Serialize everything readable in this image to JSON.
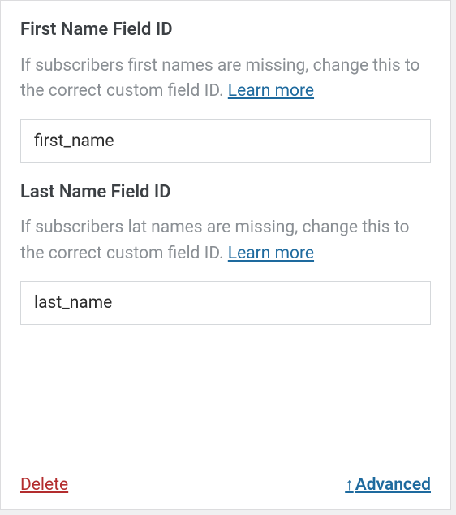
{
  "fields": {
    "firstName": {
      "label": "First Name Field ID",
      "description": "If subscribers first names are missing, change this to the correct custom field ID. ",
      "learnMore": "Learn more",
      "value": "first_name"
    },
    "lastName": {
      "label": "Last Name Field ID",
      "description": "If subscribers lat names are missing, change this to the correct custom field ID. ",
      "learnMore": "Learn more",
      "value": "last_name"
    }
  },
  "actions": {
    "delete": "Delete",
    "advanced": "Advanced"
  }
}
